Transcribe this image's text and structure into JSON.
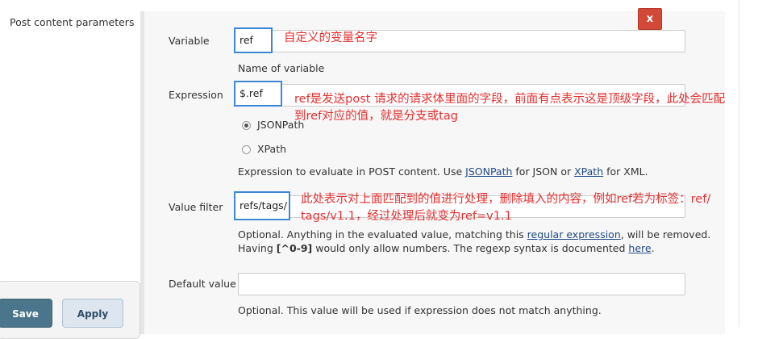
{
  "left": {
    "section_label": "Post content parameters",
    "save_label": "Save",
    "apply_label": "Apply"
  },
  "close_label": "x",
  "variable": {
    "label": "Variable",
    "value": "ref",
    "help": "Name of variable"
  },
  "expression": {
    "label": "Expression",
    "value": "$.ref",
    "options": [
      "JSONPath",
      "XPath"
    ],
    "selected": "JSONPath",
    "help_prefix": "Expression to evaluate in POST content. Use ",
    "help_link1": "JSONPath",
    "help_middle": " for JSON or ",
    "help_link2": "XPath",
    "help_suffix": " for XML."
  },
  "value_filter": {
    "label": "Value filter",
    "value": "refs/tags/",
    "help_line1_prefix": "Optional. Anything in the evaluated value, matching this ",
    "help_line1_link": "regular expression",
    "help_line1_suffix": ", will be removed.",
    "help_line2_prefix": "Having ",
    "help_line2_code": "[^0-9]",
    "help_line2_middle": " would only allow numbers. The regexp syntax is documented ",
    "help_line2_link": "here",
    "help_line2_suffix": "."
  },
  "default_value": {
    "label": "Default value",
    "value": "",
    "help": "Optional. This value will be used if expression does not match anything."
  },
  "annotations": {
    "variable_note": "自定义的变量名字",
    "expression_note_line1": "ref是发送post 请求的请求体里面的字段，前面有点表示这是顶级字段，此处会匹配",
    "expression_note_line2": "到ref对应的值，就是分支或tag",
    "filter_note_line1": "此处表示对上面匹配到的值进行处理，删除填入的内容，例如ref若为标签：ref/",
    "filter_note_line2": "tags/v1.1，经过处理后就变为ref=v1.1"
  },
  "colors": {
    "annotation_text": "#e62e2e",
    "highlight_border": "#3c87d6",
    "save_button": "#4b758b",
    "close_button": "#d24939",
    "link": "#204a87"
  }
}
